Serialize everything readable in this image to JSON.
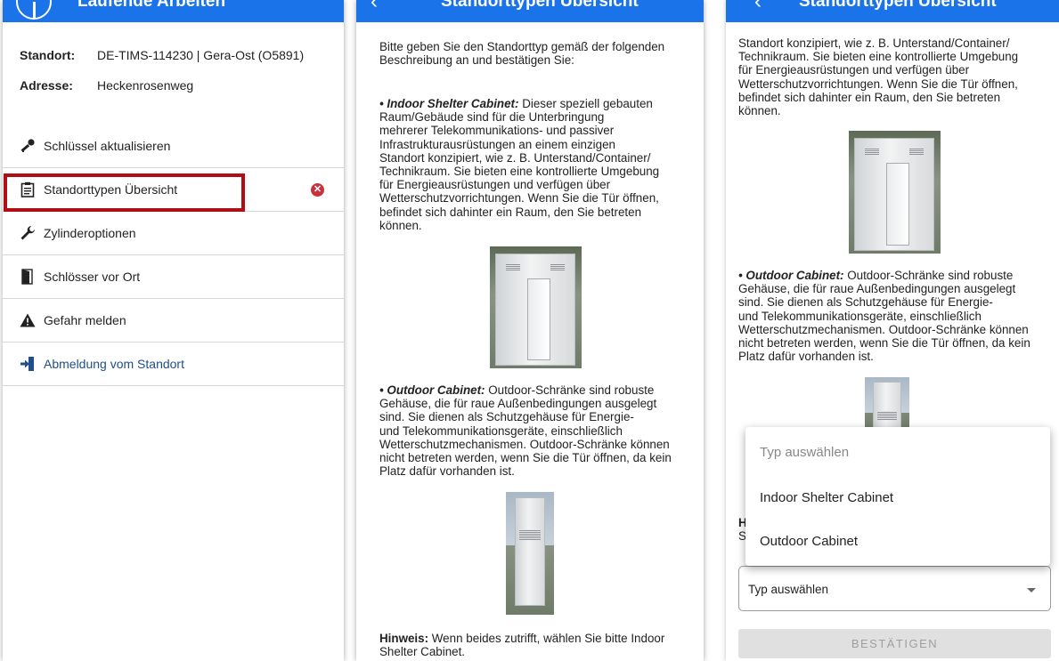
{
  "panel1": {
    "header_title": "Laufende Arbeiten",
    "standort_label": "Standort:",
    "standort_value": "DE-TIMS-114230 | Gera-Ost (O5891)",
    "adresse_label": "Adresse:",
    "adresse_value": "Heckenrosenweg",
    "menu": [
      {
        "label": "Schlüssel aktualisieren",
        "icon": "key-icon"
      },
      {
        "label": "Standorttypen Übersicht",
        "icon": "clipboard-icon",
        "status": "error-icon"
      },
      {
        "label": "Zylinderoptionen",
        "icon": "wrench-icon"
      },
      {
        "label": "Schlösser vor Ort",
        "icon": "door-icon"
      },
      {
        "label": "Gefahr melden",
        "icon": "warning-icon"
      },
      {
        "label": "Abmeldung vom Standort",
        "icon": "logout-icon"
      }
    ],
    "error_glyph": "✕",
    "colors": {
      "appbar": "#1a73e8",
      "highlight": "#b00e14",
      "error": "#c8323c",
      "logout_text": "#1f4e8a"
    }
  },
  "panel2": {
    "header_title": "Standorttypen Übersicht",
    "intro_line1": "Bitte geben Sie den Standorttyp gemäß der folgenden",
    "intro_line2": "Beschreibung an und bestätigen Sie:",
    "indoor_title": "• Indoor Shelter Cabinet:",
    "indoor_lines": [
      " Dieser speziell gebauten",
      "Raum/Gebäude sind für die Unterbringung",
      "mehrerer Telekommunikations- und passiver",
      "Infrastrukturausrüstungen an einem einzigen",
      "Standort konzipiert, wie z. B. Unterstand/Container/",
      "Technikraum. Sie bieten eine kontrollierte Umgebung",
      "für Energieausrüstungen und verfügen über",
      "Wetterschutzvorrichtungen. Wenn Sie die Tür öffnen,",
      "befindet sich dahinter ein Raum, den Sie betreten",
      "können."
    ],
    "outdoor_title": "• Outdoor Cabinet:",
    "outdoor_lines": [
      " Outdoor-Schränke sind robuste",
      "Gehäuse, die für raue Außenbedingungen ausgelegt",
      "sind. Sie dienen als Schutzgehäuse für Energie-",
      "und Telekommunikationsgeräte, einschließlich",
      "Wetterschutzmechanismen. Outdoor-Schränke können",
      "nicht betreten werden, wenn Sie die Tür öffnen, da kein",
      "Platz dafür vorhanden ist."
    ],
    "hinweis_label": "Hinweis:",
    "hinweis_text": " Wenn beides zutrifft, wählen Sie bitte Indoor",
    "hinweis_line2": "Shelter Cabinet."
  },
  "panel3": {
    "header_title": "Standorttypen Übersicht",
    "top_lines": [
      "Standort konzipiert, wie z. B. Unterstand/Container/",
      "Technikraum. Sie bieten eine kontrollierte Umgebung",
      "für Energieausrüstungen und verfügen über",
      "Wetterschutzvorrichtungen. Wenn Sie die Tür öffnen,",
      "befindet sich dahinter ein Raum, den Sie betreten",
      "können."
    ],
    "outdoor_title": "• Outdoor Cabinet:",
    "outdoor_lines": [
      " Outdoor-Schränke sind robuste",
      "Gehäuse, die für raue Außenbedingungen ausgelegt",
      "sind. Sie dienen als Schutzgehäuse für Energie-",
      "und Telekommunikationsgeräte, einschließlich",
      "Wetterschutzmechanismen. Outdoor-Schränke können",
      "nicht betreten werden, wenn Sie die Tür öffnen, da kein",
      "Platz dafür vorhanden ist."
    ],
    "dropdown": {
      "placeholder": "Typ auswählen",
      "options": [
        "Indoor Shelter Cabinet",
        "Outdoor Cabinet"
      ]
    },
    "peek_h": "H",
    "peek_s": "S",
    "select_value": "Typ auswählen",
    "confirm_label": "BESTÄTIGEN"
  }
}
